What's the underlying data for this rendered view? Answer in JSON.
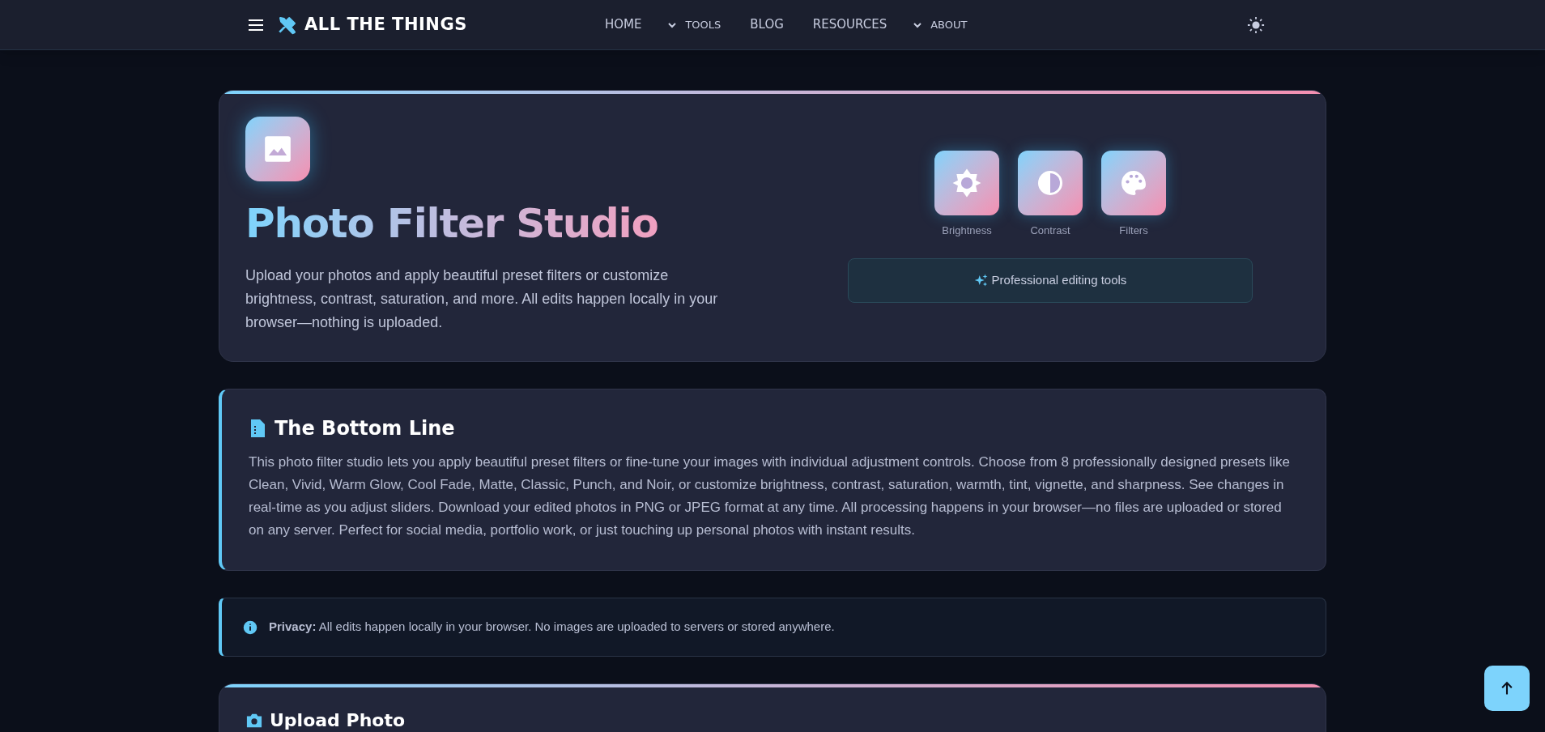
{
  "header": {
    "logo": "ALL THE THINGS",
    "nav": [
      {
        "label": "HOME",
        "kind": "link"
      },
      {
        "label": "TOOLS",
        "kind": "dropdown"
      },
      {
        "label": "BLOG",
        "kind": "link"
      },
      {
        "label": "RESOURCES",
        "kind": "link"
      },
      {
        "label": "ABOUT",
        "kind": "dropdown"
      }
    ]
  },
  "hero": {
    "title": "Photo Filter Studio",
    "description": "Upload your photos and apply beautiful preset filters or customize brightness, contrast, saturation, and more. All edits happen locally in your browser—nothing is uploaded.",
    "features": [
      {
        "label": "Brightness",
        "kind": "brightness"
      },
      {
        "label": "Contrast",
        "kind": "contrast"
      },
      {
        "label": "Filters",
        "kind": "palette"
      }
    ],
    "badge": "Professional editing tools"
  },
  "bottom_line": {
    "title": "The Bottom Line",
    "text": "This photo filter studio lets you apply beautiful preset filters or fine-tune your images with individual adjustment controls. Choose from 8 professionally designed presets like Clean, Vivid, Warm Glow, Cool Fade, Matte, Classic, Punch, and Noir, or customize brightness, contrast, saturation, warmth, tint, vignette, and sharpness. See changes in real-time as you adjust sliders. Download your edited photos in PNG or JPEG format at any time. All processing happens in your browser—no files are uploaded or stored on any server. Perfect for social media, portfolio work, or just touching up personal photos with instant results."
  },
  "privacy": {
    "text": "**Privacy:** All edits happen locally in your browser. No images are uploaded to servers or stored anywhere."
  },
  "upload": {
    "title": "Upload Photo"
  }
}
